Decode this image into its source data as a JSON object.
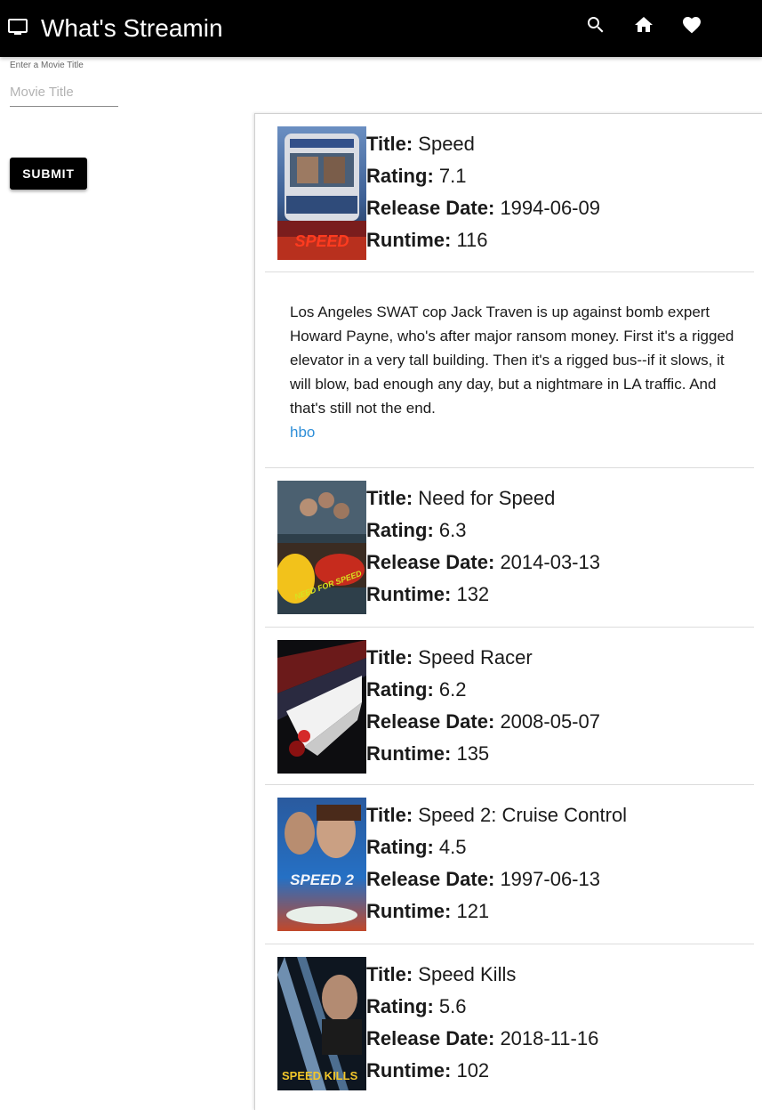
{
  "appbar": {
    "title": "What's Streamin",
    "icons": [
      "tv-icon",
      "search-icon",
      "home-icon",
      "heart-icon"
    ]
  },
  "search_form": {
    "label": "Enter a Movie Title",
    "placeholder": "Movie Title",
    "value": "",
    "submit_label": "SUBMIT"
  },
  "field_labels": {
    "title": "Title:",
    "rating": "Rating:",
    "release_date": "Release Date:",
    "runtime": "Runtime:"
  },
  "results": [
    {
      "title": "Speed",
      "rating": "7.1",
      "release_date": "1994-06-09",
      "runtime": "116"
    },
    {
      "title": "Need for Speed",
      "rating": "6.3",
      "release_date": "2014-03-13",
      "runtime": "132"
    },
    {
      "title": "Speed Racer",
      "rating": "6.2",
      "release_date": "2008-05-07",
      "runtime": "135"
    },
    {
      "title": "Speed 2: Cruise Control",
      "rating": "4.5",
      "release_date": "1997-06-13",
      "runtime": "121"
    },
    {
      "title": "Speed Kills",
      "rating": "5.6",
      "release_date": "2018-11-16",
      "runtime": "102"
    }
  ],
  "expanded": {
    "overview": "Los Angeles SWAT cop Jack Traven is up against bomb expert Howard Payne, who's after major ransom money. First it's a rigged elevator in a very tall building. Then it's a rigged bus--if it slows, it will blow, bad enough any day, but a nightmare in LA traffic. And that's still not the end.",
    "provider": "hbo"
  },
  "posters": {
    "speed_text": "SPEED",
    "need_for_speed_text": "NEED FOR SPEED",
    "speed2_text": "SPEED 2",
    "speed_kills_text": "SPEED KILLS"
  },
  "colors": {
    "appbar": "#000000",
    "link": "#2f8fd8"
  }
}
